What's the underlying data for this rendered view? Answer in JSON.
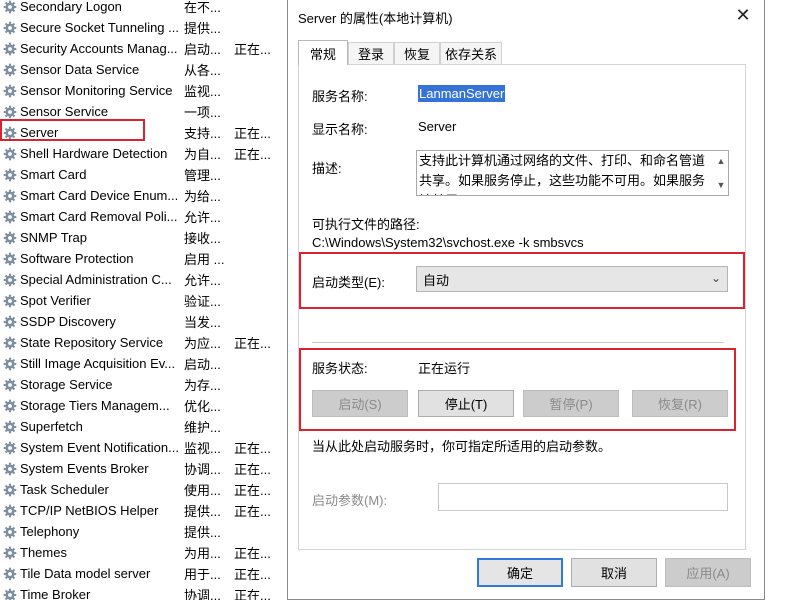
{
  "services": [
    {
      "name": "Secondary Logon",
      "desc": "在不...",
      "status": ""
    },
    {
      "name": "Secure Socket Tunneling ...",
      "desc": "提供...",
      "status": ""
    },
    {
      "name": "Security Accounts Manag...",
      "desc": "启动...",
      "status": "正在..."
    },
    {
      "name": "Sensor Data Service",
      "desc": "从各...",
      "status": ""
    },
    {
      "name": "Sensor Monitoring Service",
      "desc": "监视...",
      "status": ""
    },
    {
      "name": "Sensor Service",
      "desc": "一项...",
      "status": ""
    },
    {
      "name": "Server",
      "desc": "支持...",
      "status": "正在..."
    },
    {
      "name": "Shell Hardware Detection",
      "desc": "为自...",
      "status": "正在..."
    },
    {
      "name": "Smart Card",
      "desc": "管理...",
      "status": ""
    },
    {
      "name": "Smart Card Device Enum...",
      "desc": "为给...",
      "status": ""
    },
    {
      "name": "Smart Card Removal Poli...",
      "desc": "允许...",
      "status": ""
    },
    {
      "name": "SNMP Trap",
      "desc": "接收...",
      "status": ""
    },
    {
      "name": "Software Protection",
      "desc": "启用 ...",
      "status": ""
    },
    {
      "name": "Special Administration C...",
      "desc": "允许...",
      "status": ""
    },
    {
      "name": "Spot Verifier",
      "desc": "验证...",
      "status": ""
    },
    {
      "name": "SSDP Discovery",
      "desc": "当发...",
      "status": ""
    },
    {
      "name": "State Repository Service",
      "desc": "为应...",
      "status": "正在..."
    },
    {
      "name": "Still Image Acquisition Ev...",
      "desc": "启动...",
      "status": ""
    },
    {
      "name": "Storage Service",
      "desc": "为存...",
      "status": ""
    },
    {
      "name": "Storage Tiers Managem...",
      "desc": "优化...",
      "status": ""
    },
    {
      "name": "Superfetch",
      "desc": "维护...",
      "status": ""
    },
    {
      "name": "System Event Notification...",
      "desc": "监视...",
      "status": "正在..."
    },
    {
      "name": "System Events Broker",
      "desc": "协调...",
      "status": "正在..."
    },
    {
      "name": "Task Scheduler",
      "desc": "使用...",
      "status": "正在..."
    },
    {
      "name": "TCP/IP NetBIOS Helper",
      "desc": "提供...",
      "status": "正在..."
    },
    {
      "name": "Telephony",
      "desc": "提供...",
      "status": ""
    },
    {
      "name": "Themes",
      "desc": "为用...",
      "status": "正在..."
    },
    {
      "name": "Tile Data model server",
      "desc": "用于...",
      "status": "正在..."
    },
    {
      "name": "Time Broker",
      "desc": "协调...",
      "status": "正在..."
    }
  ],
  "dialog": {
    "title": "Server 的属性(本地计算机)",
    "close_icon": "close-icon",
    "tabs": [
      "常规",
      "登录",
      "恢复",
      "依存关系"
    ],
    "service_name_label": "服务名称:",
    "service_name_value": "LanmanServer",
    "display_name_label": "显示名称:",
    "display_name_value": "Server",
    "description_label": "描述:",
    "description_text": "支持此计算机通过网络的文件、打印、和命名管道共享。如果服务停止，这些功能不可用。如果服务被禁用，",
    "exe_path_label": "可执行文件的路径:",
    "exe_path_value": "C:\\Windows\\System32\\svchost.exe -k smbsvcs",
    "startup_type_label": "启动类型(E):",
    "startup_type_value": "自动",
    "service_status_label": "服务状态:",
    "service_status_value": "正在运行",
    "start_button": "启动(S)",
    "stop_button": "停止(T)",
    "pause_button": "暂停(P)",
    "resume_button": "恢复(R)",
    "hint_text": "当从此处启动服务时，你可指定所适用的启动参数。",
    "start_params_label": "启动参数(M):",
    "start_params_value": "",
    "ok_button": "确定",
    "cancel_button": "取消",
    "apply_button": "应用(A)"
  },
  "colors": {
    "highlight_red": "#d9232e",
    "selection_blue": "#3574d6",
    "primary_focus_blue": "#2f7bd7"
  }
}
